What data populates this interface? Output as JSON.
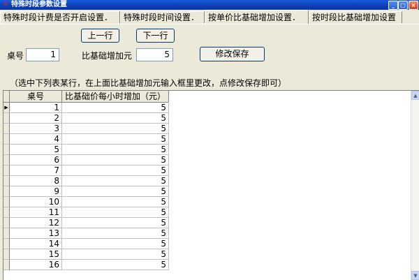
{
  "window": {
    "title": "特殊时段参数设置",
    "minimize": "_",
    "maximize": "□",
    "close": "×"
  },
  "tabs": [
    {
      "label": "特殊时段计费是否开启设置．"
    },
    {
      "label": "特殊时段时间设置．"
    },
    {
      "label": "按单价比基础增加设置．"
    },
    {
      "label": "按时段比基础增加设置"
    }
  ],
  "nav": {
    "prev_label": "上一行",
    "next_label": "下一行"
  },
  "form": {
    "table_label": "桌号",
    "table_value": "1",
    "increase_label": "比基础增加元",
    "increase_value": "5",
    "save_label": "修改保存"
  },
  "hint": "（选中下列表某行，在上面比基础增加元输入框里更改，点修改保存即可）",
  "grid": {
    "columns": [
      "桌号",
      "比基础价每小时增加（元）"
    ],
    "current_row_marker": "▶",
    "rows": [
      [
        "1",
        "5"
      ],
      [
        "2",
        "5"
      ],
      [
        "3",
        "5"
      ],
      [
        "4",
        "5"
      ],
      [
        "5",
        "5"
      ],
      [
        "6",
        "5"
      ],
      [
        "7",
        "5"
      ],
      [
        "8",
        "5"
      ],
      [
        "9",
        "5"
      ],
      [
        "10",
        "5"
      ],
      [
        "11",
        "5"
      ],
      [
        "12",
        "5"
      ],
      [
        "13",
        "5"
      ],
      [
        "14",
        "5"
      ],
      [
        "15",
        "5"
      ],
      [
        "16",
        "5"
      ]
    ]
  },
  "scrollbar": {
    "up": "▲",
    "down": "▼"
  }
}
